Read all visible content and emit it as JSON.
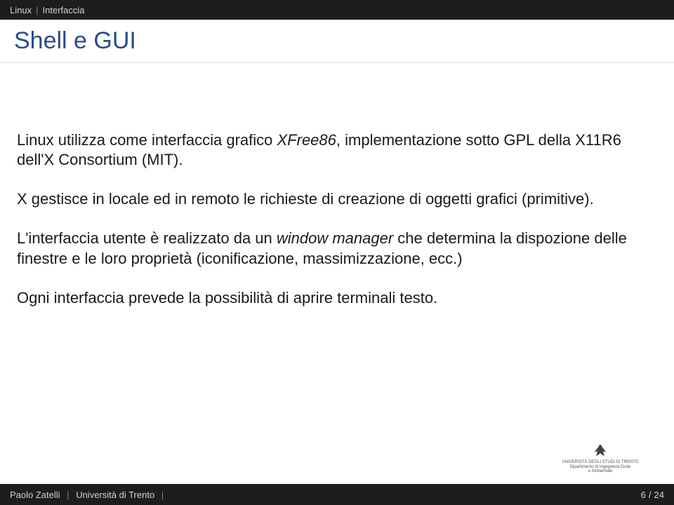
{
  "breadcrumb": {
    "a": "Linux",
    "b": "Interfaccia"
  },
  "title": "Shell e GUI",
  "body": {
    "p1_pre": "Linux utilizza come interfaccia grafico ",
    "p1_it": "XFree86",
    "p1_post": ", implementazione sotto GPL della X11R6 dell'X Consortium (MIT).",
    "p2": "X gestisce in locale ed in remoto le richieste di creazione di oggetti grafici (primitive).",
    "p3_pre": "L'interfaccia utente è realizzato da un ",
    "p3_it": "window manager",
    "p3_post": " che determina la dispozione delle finestre e le loro proprietà (iconificazione, massimizzazione, ecc.)",
    "p4": "Ogni interfaccia prevede la possibilità di aprire terminali testo."
  },
  "logo": {
    "line1": "UNIVERSITÀ DEGLI STUDI DI TRENTO",
    "line2": "Dipartimento di Ingegneria Civile",
    "line3": "e Ambientale"
  },
  "footer": {
    "author": "Paolo Zatelli",
    "affiliation": "Università di Trento",
    "page_current": "6",
    "page_sep": "/",
    "page_total": "24"
  }
}
